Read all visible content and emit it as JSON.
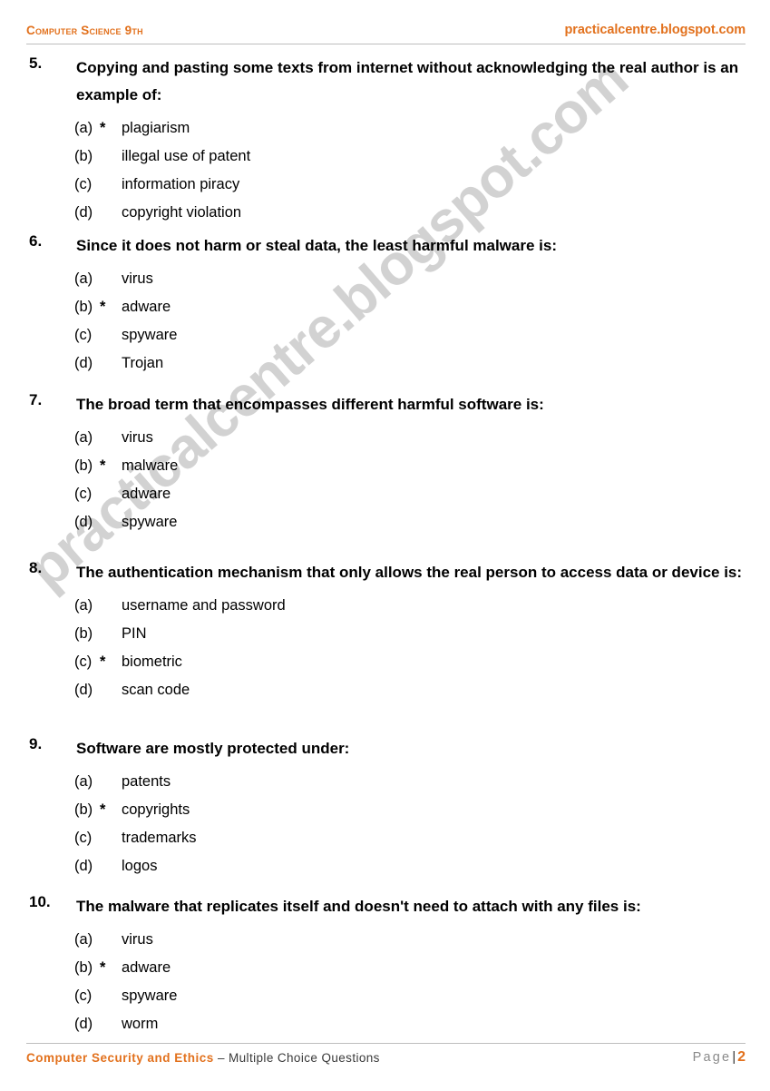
{
  "header": {
    "left_title": "Computer Science 9th",
    "right_site": "practicalcentre.blogspot.com"
  },
  "watermark": {
    "text": "practicalcentre.blogspot.com"
  },
  "questions": [
    {
      "number": "5.",
      "text": "Copying and pasting some texts from internet without acknowledging the real author is an example of:",
      "options": [
        {
          "label": "(a)",
          "marker": "*",
          "text": "plagiarism"
        },
        {
          "label": "(b)",
          "marker": "",
          "text": "illegal use of patent"
        },
        {
          "label": "(c)",
          "marker": "",
          "text": "information piracy"
        },
        {
          "label": "(d)",
          "marker": "",
          "text": "copyright violation"
        }
      ]
    },
    {
      "number": "6.",
      "text": "Since it does not harm or steal data, the least harmful malware is:",
      "options": [
        {
          "label": "(a)",
          "marker": "",
          "text": "virus"
        },
        {
          "label": "(b)",
          "marker": "*",
          "text": "adware"
        },
        {
          "label": "(c)",
          "marker": "",
          "text": "spyware"
        },
        {
          "label": "(d)",
          "marker": "",
          "text": "Trojan"
        }
      ]
    },
    {
      "number": "7.",
      "text": "The broad term that encompasses different harmful software is:",
      "options": [
        {
          "label": "(a)",
          "marker": "",
          "text": "virus"
        },
        {
          "label": "(b)",
          "marker": "*",
          "text": "malware"
        },
        {
          "label": "(c)",
          "marker": "",
          "text": "adware"
        },
        {
          "label": "(d)",
          "marker": "",
          "text": "spyware"
        }
      ]
    },
    {
      "number": "8.",
      "text": "The authentication mechanism that only allows the real person to access data or device is:",
      "options": [
        {
          "label": "(a)",
          "marker": "",
          "text": "username and password"
        },
        {
          "label": "(b)",
          "marker": "",
          "text": "PIN"
        },
        {
          "label": "(c)",
          "marker": "*",
          "text": "biometric"
        },
        {
          "label": "(d)",
          "marker": "",
          "text": "scan code"
        }
      ]
    },
    {
      "number": "9.",
      "text": "Software are mostly protected under:",
      "options": [
        {
          "label": "(a)",
          "marker": "",
          "text": "patents"
        },
        {
          "label": "(b)",
          "marker": "*",
          "text": "copyrights"
        },
        {
          "label": "(c)",
          "marker": "",
          "text": "trademarks"
        },
        {
          "label": "(d)",
          "marker": "",
          "text": "logos"
        }
      ]
    },
    {
      "number": "10.",
      "text": "The malware that replicates itself and doesn't need to attach with any files is:",
      "options": [
        {
          "label": "(a)",
          "marker": "",
          "text": "virus"
        },
        {
          "label": "(b)",
          "marker": "*",
          "text": "adware"
        },
        {
          "label": "(c)",
          "marker": "",
          "text": "spyware"
        },
        {
          "label": "(d)",
          "marker": "",
          "text": "worm"
        }
      ]
    }
  ],
  "footer": {
    "title": "Computer Security and Ethics",
    "subtitle": " – Multiple Choice Questions",
    "page_word": "Page",
    "page_separator": "|",
    "page_number": "2"
  },
  "layout": {
    "question_tops": [
      60,
      256,
      431,
      616,
      810,
      984
    ],
    "question_text_widths": [
      740,
      740,
      740,
      740,
      740,
      740
    ]
  },
  "colors": {
    "accent": "#e2711d",
    "text": "#000000",
    "rule": "#bdbdbd",
    "watermark": "#d2d2d2",
    "footer_sub": "#3a3a3a",
    "page_word": "#8a8a8a"
  }
}
